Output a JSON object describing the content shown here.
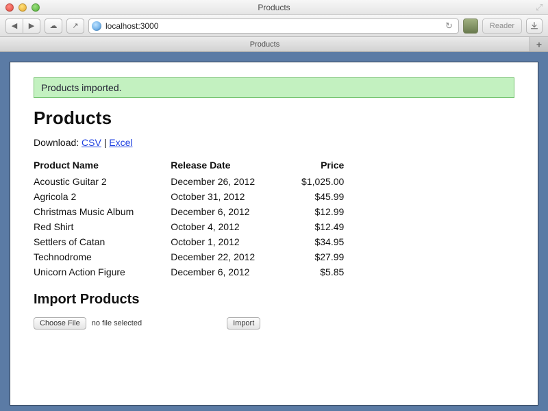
{
  "window": {
    "title": "Products"
  },
  "toolbar": {
    "back_label": "◀",
    "forward_label": "▶",
    "share_label": "↗",
    "reload_label": "↻",
    "reader_label": "Reader",
    "url": "localhost:3000"
  },
  "tabs": [
    {
      "label": "Products"
    }
  ],
  "flash": {
    "message": "Products imported."
  },
  "page": {
    "title": "Products",
    "download_label": "Download:",
    "csv_link": "CSV",
    "separator": " | ",
    "excel_link": "Excel"
  },
  "table": {
    "headers": {
      "name": "Product Name",
      "date": "Release Date",
      "price": "Price"
    },
    "rows": [
      {
        "name": "Acoustic Guitar 2",
        "date": "December 26, 2012",
        "price": "$1,025.00"
      },
      {
        "name": "Agricola 2",
        "date": "October 31, 2012",
        "price": "$45.99"
      },
      {
        "name": "Christmas Music Album",
        "date": "December 6, 2012",
        "price": "$12.99"
      },
      {
        "name": "Red Shirt",
        "date": "October 4, 2012",
        "price": "$12.49"
      },
      {
        "name": "Settlers of Catan",
        "date": "October 1, 2012",
        "price": "$34.95"
      },
      {
        "name": "Technodrome",
        "date": "December 22, 2012",
        "price": "$27.99"
      },
      {
        "name": "Unicorn Action Figure",
        "date": "December 6, 2012",
        "price": "$5.85"
      }
    ]
  },
  "import": {
    "title": "Import Products",
    "choose_file_label": "Choose File",
    "no_file_label": "no file selected",
    "submit_label": "Import"
  }
}
